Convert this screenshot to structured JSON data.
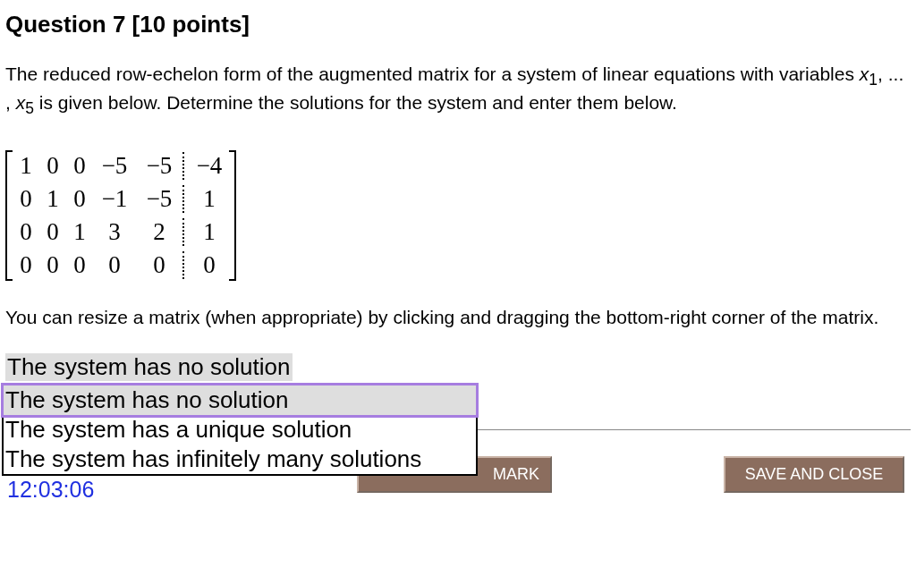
{
  "title": "Question 7 [10 points]",
  "prompt": "The reduced row-echelon form of the augmented matrix for a system of linear equations with variables *x*$_{1}$, ... , *x*$_{5}$ is given below. Determine the solutions for the system and enter them below.",
  "matrix": {
    "rows": [
      {
        "coefficients": [
          "1",
          "0",
          "0",
          "−5",
          "−5"
        ],
        "constant": "−4"
      },
      {
        "coefficients": [
          "0",
          "1",
          "0",
          "−1",
          "−5"
        ],
        "constant": "1"
      },
      {
        "coefficients": [
          "0",
          "0",
          "1",
          "3",
          "2"
        ],
        "constant": "1"
      },
      {
        "coefficients": [
          "0",
          "0",
          "0",
          "0",
          "0"
        ],
        "constant": "0"
      }
    ]
  },
  "hint": "You can resize a matrix (when appropriate) by clicking and dragging the bottom-right corner of the matrix.",
  "select": {
    "value": "The system has no solution",
    "options": [
      {
        "label": "The system has no solution",
        "selected": true
      },
      {
        "label": "The system has a unique solution",
        "selected": false
      },
      {
        "label": "The system has infinitely many solutions",
        "selected": false
      }
    ]
  },
  "timer": "12:03:06",
  "buttons": [
    {
      "label": "MARK",
      "kind": "submit"
    },
    {
      "label": "SAVE AND CLOSE",
      "kind": "save"
    }
  ]
}
